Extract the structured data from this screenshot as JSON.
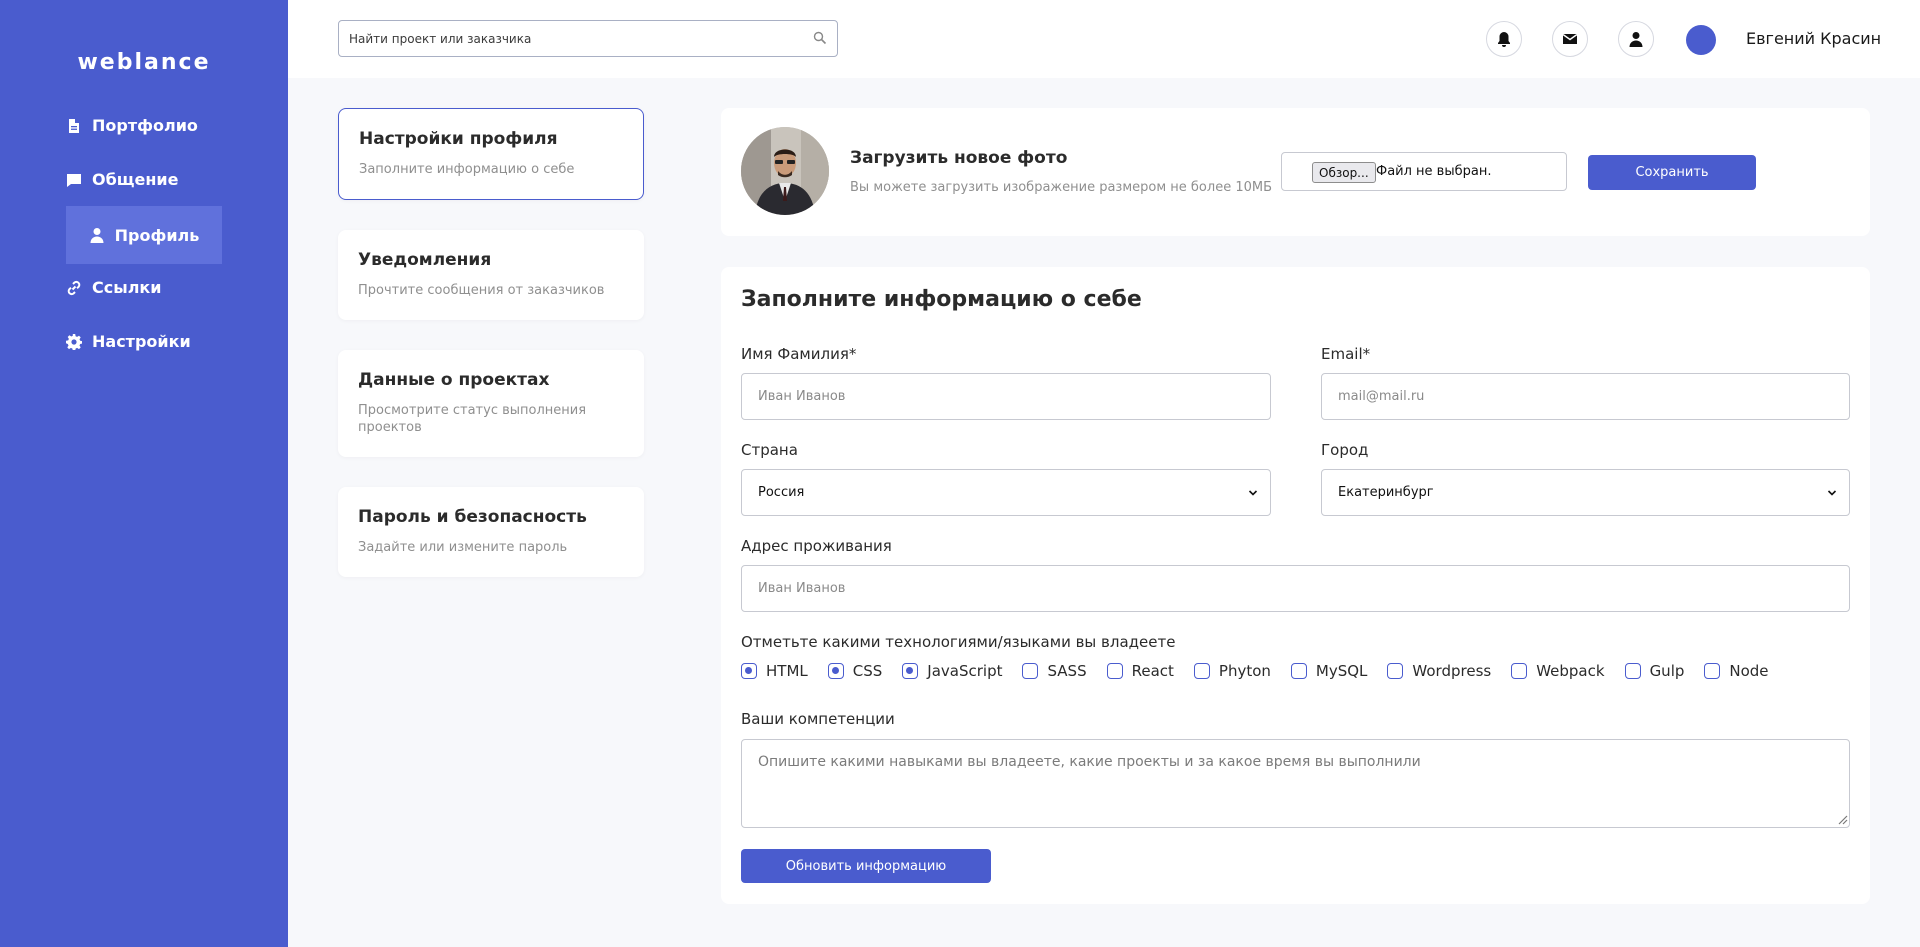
{
  "brand": {
    "logo": "weblance",
    "accent": "#4a5cce"
  },
  "sidebar": {
    "items": [
      {
        "label": "Портфолио",
        "icon": "document-icon"
      },
      {
        "label": "Общение",
        "icon": "chat-icon"
      },
      {
        "label": "Профиль",
        "icon": "user-icon",
        "active": true
      },
      {
        "label": "Ссылки",
        "icon": "link-icon"
      },
      {
        "label": "Настройки",
        "icon": "gear-icon"
      }
    ]
  },
  "header": {
    "search_placeholder": "Найти проект или заказчика",
    "icons": [
      "bell-icon",
      "mail-icon",
      "user-icon"
    ],
    "user_name": "Евгений Красин"
  },
  "settings_menu": [
    {
      "title": "Настройки профиля",
      "desc": "Заполните информацию о себе",
      "active": true
    },
    {
      "title": "Уведомления",
      "desc": "Прочтите сообщения от заказчиков"
    },
    {
      "title": "Данные о проектах",
      "desc": "Просмотрите статус выполнения проектов"
    },
    {
      "title": "Пароль и безопасность",
      "desc": "Задайте или измените пароль"
    }
  ],
  "photo": {
    "title": "Загрузить новое фото",
    "hint": "Вы можете загрузить изображение размером не более 10МБ",
    "browse_label": "Обзор...",
    "file_status": "Файл не выбран.",
    "save_label": "Сохранить"
  },
  "form": {
    "title": "Заполните информацию о себе",
    "name_label": "Имя Фамилия*",
    "name_placeholder": "Иван Иванов",
    "email_label": "Email*",
    "email_placeholder": "mail@mail.ru",
    "country_label": "Страна",
    "country_value": "Россия",
    "city_label": "Город",
    "city_value": "Екатеринбург",
    "address_label": "Адрес проживания",
    "address_placeholder": "Иван Иванов",
    "tech_label": "Отметьте какими технологиями/языками вы владеете",
    "techs": [
      {
        "label": "HTML",
        "checked": true
      },
      {
        "label": "CSS",
        "checked": true
      },
      {
        "label": "JavaScript",
        "checked": true
      },
      {
        "label": "SASS",
        "checked": false
      },
      {
        "label": "React",
        "checked": false
      },
      {
        "label": "Phyton",
        "checked": false
      },
      {
        "label": "MySQL",
        "checked": false
      },
      {
        "label": "Wordpress",
        "checked": false
      },
      {
        "label": "Webpack",
        "checked": false
      },
      {
        "label": "Gulp",
        "checked": false
      },
      {
        "label": "Node",
        "checked": false
      }
    ],
    "skills_label": "Ваши компетенции",
    "skills_placeholder": "Опишите какими навыками вы владеете, какие проекты и за какое время вы выполнили",
    "update_label": "Обновить информацию"
  }
}
